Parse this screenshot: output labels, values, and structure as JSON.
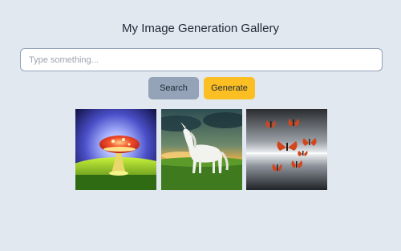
{
  "header": {
    "title": "My Image Generation Gallery"
  },
  "search": {
    "placeholder": "Type something..."
  },
  "buttons": {
    "search_label": "Search",
    "generate_label": "Generate"
  },
  "gallery": {
    "images": [
      {
        "subject": "glowing-mushroom"
      },
      {
        "subject": "white-unicorn"
      },
      {
        "subject": "orange-butterflies"
      }
    ]
  },
  "colors": {
    "background": "#e2e8f0",
    "search_button": "#94a3b8",
    "generate_button": "#fbbf24"
  }
}
